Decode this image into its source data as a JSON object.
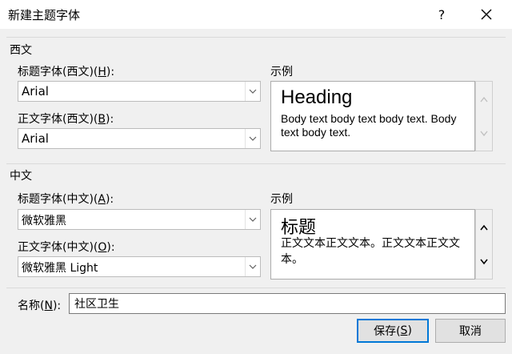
{
  "dialog": {
    "title": "新建主题字体",
    "help_symbol": "?",
    "close_icon": "close-icon"
  },
  "latin": {
    "section_title": "西文",
    "heading_font": {
      "label_main": "标题字体(西文)(",
      "label_key": "H",
      "label_end": "):",
      "value": "Arial"
    },
    "body_font": {
      "label_main": "正文字体(西文)(",
      "label_key": "B",
      "label_end": "):",
      "value": "Arial"
    },
    "sample": {
      "label": "示例",
      "heading": "Heading",
      "body": "Body text body text body text. Body text body text."
    }
  },
  "cjk": {
    "section_title": "中文",
    "heading_font": {
      "label_main": "标题字体(中文)(",
      "label_key": "A",
      "label_end": "):",
      "value": "微软雅黑"
    },
    "body_font": {
      "label_main": "正文字体(中文)(",
      "label_key": "O",
      "label_end": "):",
      "value": "微软雅黑 Light"
    },
    "sample": {
      "label": "示例",
      "heading": "标题",
      "body": "正文文本正文文本。正文文本正文文本。"
    }
  },
  "name_field": {
    "label_main": "名称(",
    "label_key": "N",
    "label_end": "):",
    "value": "社区卫生"
  },
  "buttons": {
    "save_main": "保存(",
    "save_key": "S",
    "save_end": ")",
    "cancel": "取消"
  },
  "colors": {
    "primary_border": "#0078d7",
    "dialog_bg": "#f0f0f0"
  }
}
